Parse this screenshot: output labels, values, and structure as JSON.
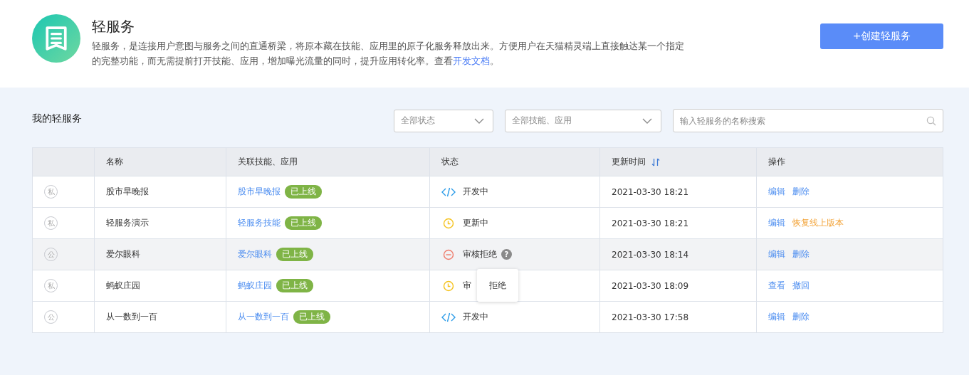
{
  "header": {
    "title": "轻服务",
    "description": "轻服务，是连接用户意图与服务之间的直通桥梁，将原本藏在技能、应用里的原子化服务释放出来。方便用户在天猫精灵端上直接触达某一个指定的完整功能，而无需提前打开技能、应用，增加曝光流量的同时，提升应用转化率。查看",
    "doc_link": "开发文档",
    "description_end": "。",
    "create_button": "+创建轻服务"
  },
  "list": {
    "title": "我的轻服务",
    "filters": [
      {
        "value": "全部状态"
      },
      {
        "value": "全部技能、应用"
      }
    ],
    "search": {
      "placeholder": "输入轻服务的名称搜索"
    },
    "columns": [
      {},
      {
        "label": "名称"
      },
      {
        "label": "关联技能、应用"
      },
      {
        "label": "状态"
      },
      {
        "label": "更新时间",
        "sortable": true
      },
      {
        "label": "操作"
      }
    ],
    "rows": [
      {
        "badge": "私",
        "name": "股市早晚报",
        "app": "股市早晚报",
        "app_tag": "已上线",
        "kind": "dev",
        "status": "开发中",
        "time": "2021-03-30 18:21",
        "highlighted": false,
        "actions": [
          {
            "label": "编辑",
            "kind": "normal"
          },
          {
            "label": "删除",
            "kind": "normal"
          }
        ]
      },
      {
        "badge": "私",
        "name": "轻服务演示",
        "app": "轻服务技能",
        "app_tag": "已上线",
        "kind": "updating",
        "status": "更新中",
        "time": "2021-03-30 18:21",
        "highlighted": false,
        "actions": [
          {
            "label": "编辑",
            "kind": "normal"
          },
          {
            "label": "恢复线上版本",
            "kind": "warning"
          }
        ]
      },
      {
        "badge": "公",
        "name": "爱尔眼科",
        "app": "爱尔眼科",
        "app_tag": "已上线",
        "kind": "rejected",
        "status": "审核拒绝",
        "help": "?",
        "tooltip": "拒绝",
        "time": "2021-03-30 18:14",
        "highlighted": true,
        "actions": [
          {
            "label": "编辑",
            "kind": "normal"
          },
          {
            "label": "删除",
            "kind": "normal"
          }
        ]
      },
      {
        "badge": "私",
        "name": "蚂蚁庄园",
        "app": "蚂蚁庄园",
        "app_tag": "已上线",
        "kind": "updating",
        "status": "审",
        "time": "2021-03-30 18:09",
        "highlighted": false,
        "actions": [
          {
            "label": "查看",
            "kind": "normal"
          },
          {
            "label": "撤回",
            "kind": "normal"
          }
        ]
      },
      {
        "badge": "公",
        "name": "从一数到一百",
        "app": "从一数到一百",
        "app_tag": "已上线",
        "kind": "dev",
        "status": "开发中",
        "time": "2021-03-30 17:58",
        "highlighted": false,
        "actions": [
          {
            "label": "编辑",
            "kind": "normal"
          },
          {
            "label": "删除",
            "kind": "normal"
          }
        ]
      }
    ]
  }
}
